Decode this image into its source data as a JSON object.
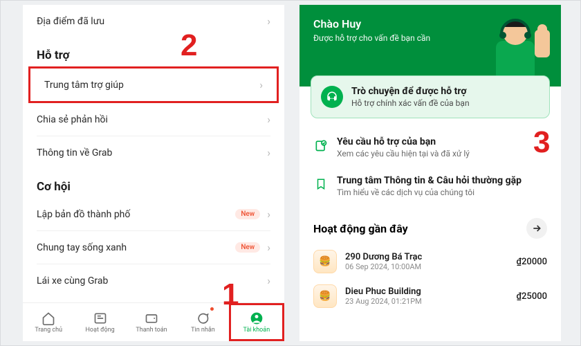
{
  "annotations": {
    "one": "1",
    "two": "2",
    "three": "3"
  },
  "left": {
    "saved_places": "Địa điểm đã lưu",
    "support_header": "Hỗ trợ",
    "help_center": "Trung tâm trợ giúp",
    "share_feedback": "Chia sẻ phản hồi",
    "about_grab": "Thông tin về Grab",
    "opportunity_header": "Cơ hội",
    "map_city": "Lập bản đồ thành phố",
    "live_green": "Chung tay sống xanh",
    "drive_with_grab": "Lái xe cùng Grab",
    "new_badge": "New",
    "nav": {
      "home": "Trang chủ",
      "activity": "Hoạt động",
      "payment": "Thanh toán",
      "messages": "Tin nhắn",
      "account": "Tài khoản"
    }
  },
  "right": {
    "greeting": "Chào Huy",
    "greeting_sub": "Được hỗ trợ cho vấn đề bạn cần",
    "chat_title": "Trò chuyện để được hỗ trợ",
    "chat_sub": "Hỗ trợ chính xác vấn đề của bạn",
    "your_requests_title": "Yêu cầu hỗ trợ của bạn",
    "your_requests_sub": "Xem các yêu cầu hiện tại và đã xử lý",
    "faq_title": "Trung tâm Thông tin & Câu hỏi thường gặp",
    "faq_sub": "Tìm hiểu về các dịch vụ của chúng tôi",
    "recent_header": "Hoạt động gần đây",
    "activities": [
      {
        "name": "290 Dương Bá Trạc",
        "date": "06 Sep 2024, 10:00AM",
        "price": "₫20000"
      },
      {
        "name": "Dieu Phuc Building",
        "date": "23 Aug 2024, 01:21PM",
        "price": "₫25000"
      }
    ]
  }
}
